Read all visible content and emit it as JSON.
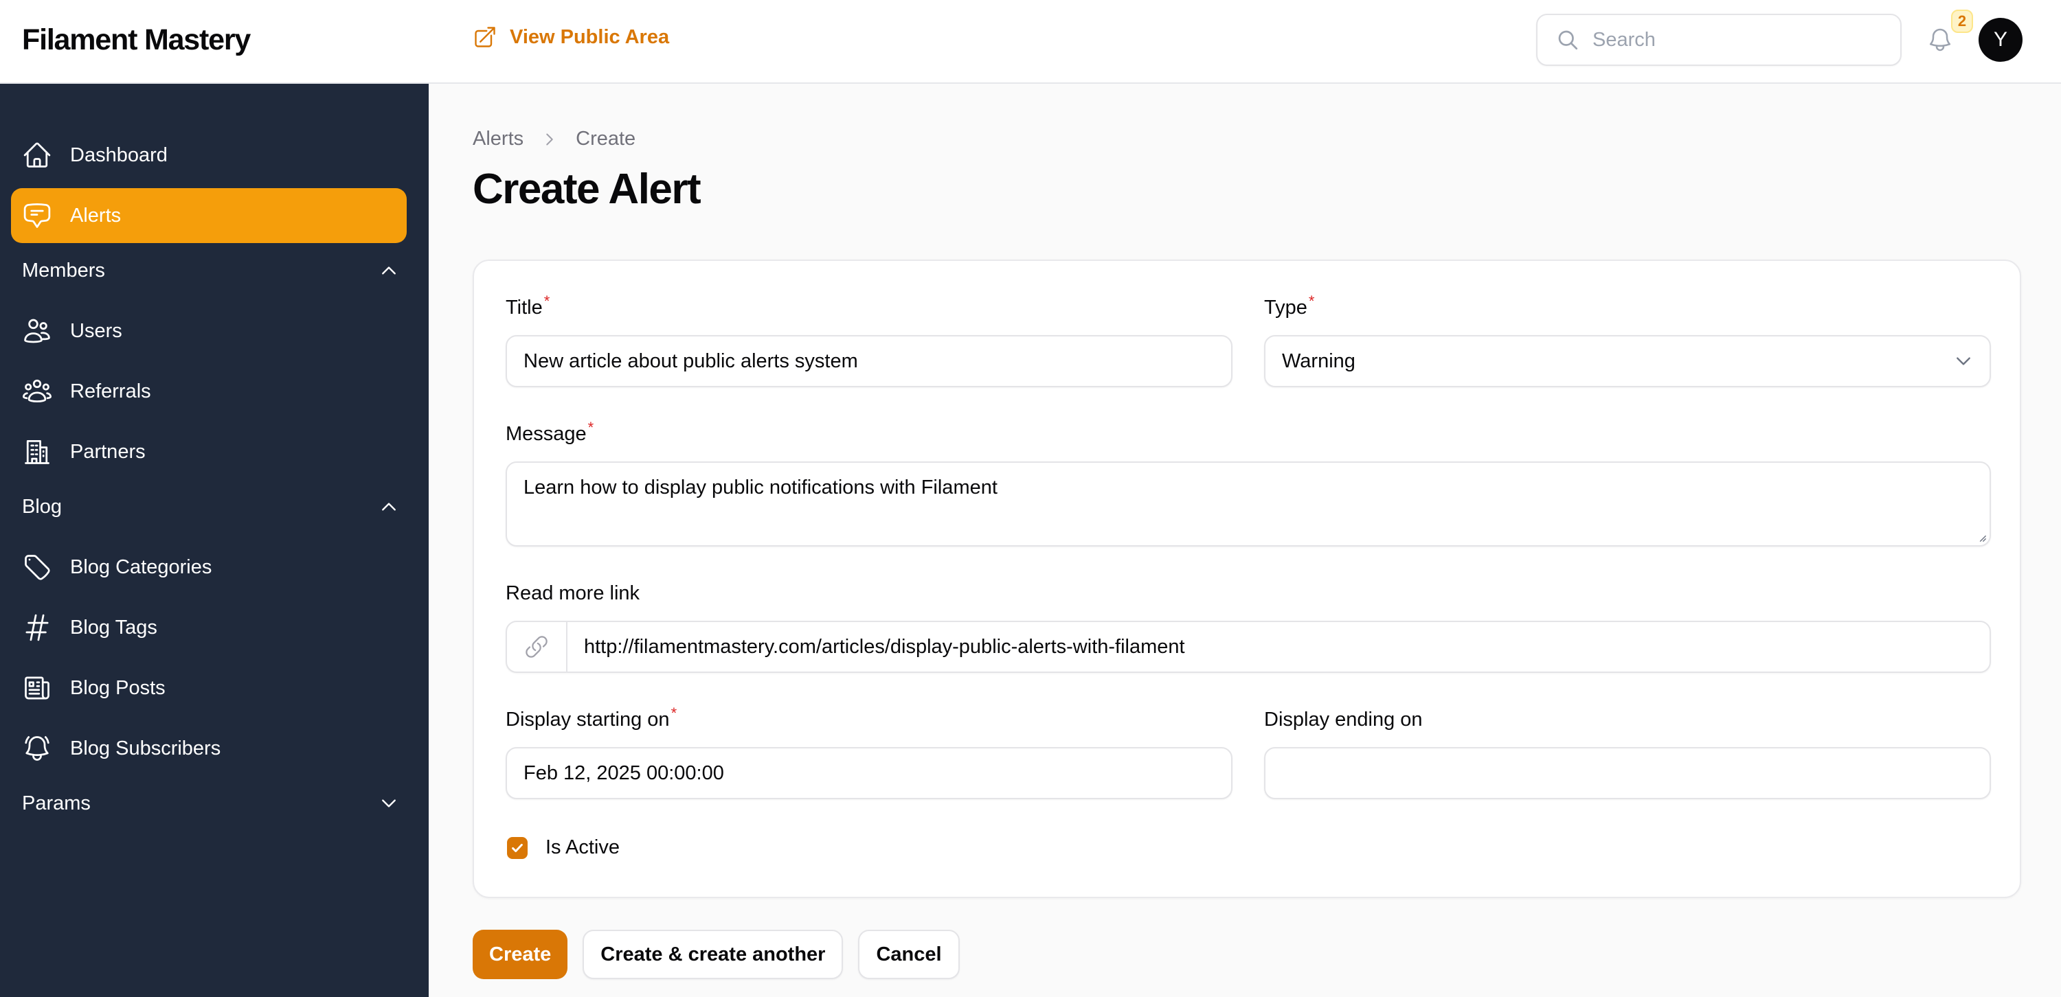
{
  "app": {
    "brand": "Filament Mastery",
    "public_link_label": "View Public Area",
    "search_placeholder": "Search",
    "notification_count": "2",
    "avatar_initial": "Y",
    "accent_color": "#f59e0b",
    "primary_button_color": "#d97706",
    "sidebar_color": "#1f293b"
  },
  "sidebar": {
    "items": [
      {
        "label": "Dashboard",
        "icon": "home-icon",
        "active": false
      },
      {
        "label": "Alerts",
        "icon": "chat-bubble-icon",
        "active": true
      }
    ],
    "groups": [
      {
        "label": "Members",
        "expanded": true,
        "items": [
          {
            "label": "Users",
            "icon": "users-icon"
          },
          {
            "label": "Referrals",
            "icon": "user-group-icon"
          },
          {
            "label": "Partners",
            "icon": "building-icon"
          }
        ]
      },
      {
        "label": "Blog",
        "expanded": true,
        "items": [
          {
            "label": "Blog Categories",
            "icon": "tag-icon"
          },
          {
            "label": "Blog Tags",
            "icon": "hashtag-icon"
          },
          {
            "label": "Blog Posts",
            "icon": "newspaper-icon"
          },
          {
            "label": "Blog Subscribers",
            "icon": "bell-alert-icon"
          }
        ]
      },
      {
        "label": "Params",
        "expanded": false,
        "items": []
      }
    ]
  },
  "page": {
    "breadcrumb": [
      "Alerts",
      "Create"
    ],
    "title": "Create Alert"
  },
  "form": {
    "title": {
      "label": "Title",
      "required": true,
      "value": "New article about public alerts system"
    },
    "type": {
      "label": "Type",
      "required": true,
      "value": "Warning"
    },
    "message": {
      "label": "Message",
      "required": true,
      "value": "Learn how to display public notifications with Filament"
    },
    "read_more_link": {
      "label": "Read more link",
      "required": false,
      "value": "http://filamentmastery.com/articles/display-public-alerts-with-filament"
    },
    "display_start": {
      "label": "Display starting on",
      "required": true,
      "value": "Feb 12, 2025 00:00:00"
    },
    "display_end": {
      "label": "Display ending on",
      "required": false,
      "value": ""
    },
    "is_active": {
      "label": "Is Active",
      "checked": true
    },
    "required_marker": "*"
  },
  "actions": {
    "create": "Create",
    "create_another": "Create & create another",
    "cancel": "Cancel"
  }
}
